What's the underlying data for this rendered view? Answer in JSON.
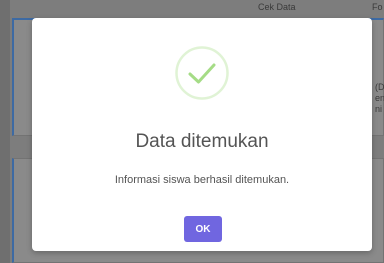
{
  "background": {
    "header_fragment_1": "Cek Data",
    "header_fragment_2": "Fo",
    "right_fragments": [
      "(D",
      "en",
      "ni"
    ]
  },
  "dialog": {
    "title": "Data ditemukan",
    "message": "Informasi siswa berhasil ditemukan.",
    "ok_label": "OK",
    "icon": "success-check-icon"
  },
  "colors": {
    "confirm_button": "#7066e0",
    "success_green": "#a5dc86",
    "overlay": "#7d7d7d"
  }
}
